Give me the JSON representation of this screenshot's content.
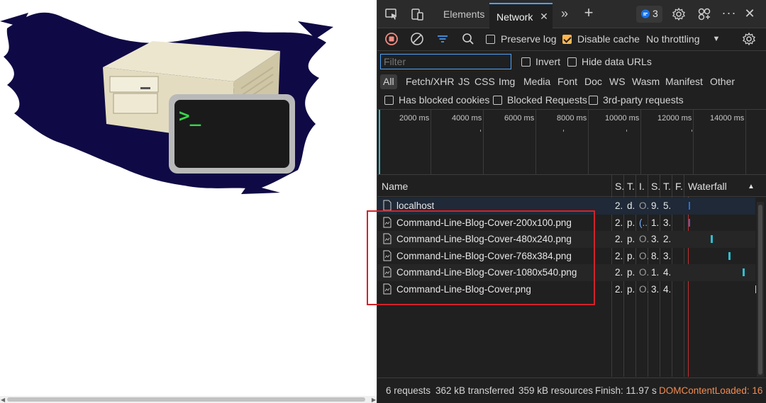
{
  "devtools": {
    "tabs": [
      {
        "label": "Elements"
      },
      {
        "label": "Network"
      }
    ],
    "issues_count": "3",
    "toolbar": {
      "preserve_log": "Preserve log",
      "disable_cache": "Disable cache",
      "throttling": "No throttling"
    },
    "filter": {
      "placeholder": "Filter",
      "invert": "Invert",
      "hide_data_urls": "Hide data URLs"
    },
    "types": [
      "All",
      "Fetch/XHR",
      "JS",
      "CSS",
      "Img",
      "Media",
      "Font",
      "Doc",
      "WS",
      "Wasm",
      "Manifest",
      "Other"
    ],
    "block": {
      "has_blocked_cookies": "Has blocked cookies",
      "blocked_requests": "Blocked Requests",
      "third_party": "3rd-party requests"
    },
    "overview_ticks": [
      "2000 ms",
      "4000 ms",
      "6000 ms",
      "8000 ms",
      "10000 ms",
      "12000 ms",
      "14000 ms"
    ],
    "table": {
      "headers": {
        "name": "Name",
        "status": "S.",
        "type": "T.",
        "initiator": "I.",
        "size": "S.",
        "time": "T.",
        "fulfilled": "F.",
        "waterfall": "Waterfall"
      },
      "rows": [
        {
          "name": "localhost",
          "status": "2.",
          "type": "d.",
          "initiator": "O.",
          "size": "9.",
          "time": "5."
        },
        {
          "name": "Command-Line-Blog-Cover-200x100.png",
          "status": "2.",
          "type": "p.",
          "initiator": "(..",
          "size": "1.",
          "time": "3."
        },
        {
          "name": "Command-Line-Blog-Cover-480x240.png",
          "status": "2.",
          "type": "p.",
          "initiator": "O.",
          "size": "3.",
          "time": "2."
        },
        {
          "name": "Command-Line-Blog-Cover-768x384.png",
          "status": "2.",
          "type": "p.",
          "initiator": "O.",
          "size": "8.",
          "time": "3."
        },
        {
          "name": "Command-Line-Blog-Cover-1080x540.png",
          "status": "2.",
          "type": "p.",
          "initiator": "O.",
          "size": "1.",
          "time": "4."
        },
        {
          "name": "Command-Line-Blog-Cover.png",
          "status": "2.",
          "type": "p.",
          "initiator": "O.",
          "size": "3.",
          "time": "4."
        }
      ]
    },
    "status": {
      "requests": "6 requests",
      "transferred": "362 kB transferred",
      "resources": "359 kB resources",
      "finish": "Finish: 11.97 s",
      "dom_content_loaded": "DOMContentLoaded: 16"
    }
  },
  "hero": {
    "terminal_prompt": ">_"
  },
  "colors": {
    "accent": "#4ba3ff",
    "checkbox_checked": "#ffb74d",
    "record_stop": "#f28b82",
    "highlight_box": "#d2232a",
    "dom_content_loaded": "#f28b50",
    "brush_stroke": "#0f0a45"
  },
  "icons": [
    "inspect-icon",
    "device-emulation-icon",
    "close-tab-icon",
    "more-tabs-icon",
    "add-tab-icon",
    "issues-icon",
    "settings-icon",
    "connection-icon",
    "more-options-icon",
    "close-devtools-icon",
    "stop-recording-icon",
    "clear-icon",
    "filter-icon",
    "search-icon",
    "dropdown-icon",
    "network-settings-icon",
    "sort-ascending-icon",
    "file-icon",
    "image-file-icon"
  ]
}
